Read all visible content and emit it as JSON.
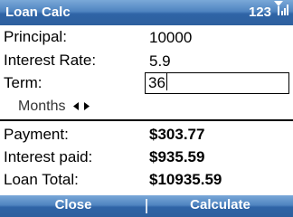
{
  "app": {
    "title": "Loan Calc"
  },
  "status": {
    "input_mode": "123",
    "signal_icon": "signal-strength-icon"
  },
  "form": {
    "principal_label": "Principal:",
    "principal_value": "10000",
    "rate_label": "Interest Rate:",
    "rate_value": "5.9",
    "term_label": "Term:",
    "term_value": "36",
    "term_unit": "Months"
  },
  "results": {
    "payment_label": "Payment:",
    "payment_value": "$303.77",
    "interest_label": "Interest paid:",
    "interest_value": "$935.59",
    "total_label": "Loan Total:",
    "total_value": "$10935.59"
  },
  "softkeys": {
    "left": "Close",
    "right": "Calculate"
  },
  "colors": {
    "title_bar": "#3a70b3",
    "softkey_bar": "#3a70b3",
    "text": "#000000"
  }
}
